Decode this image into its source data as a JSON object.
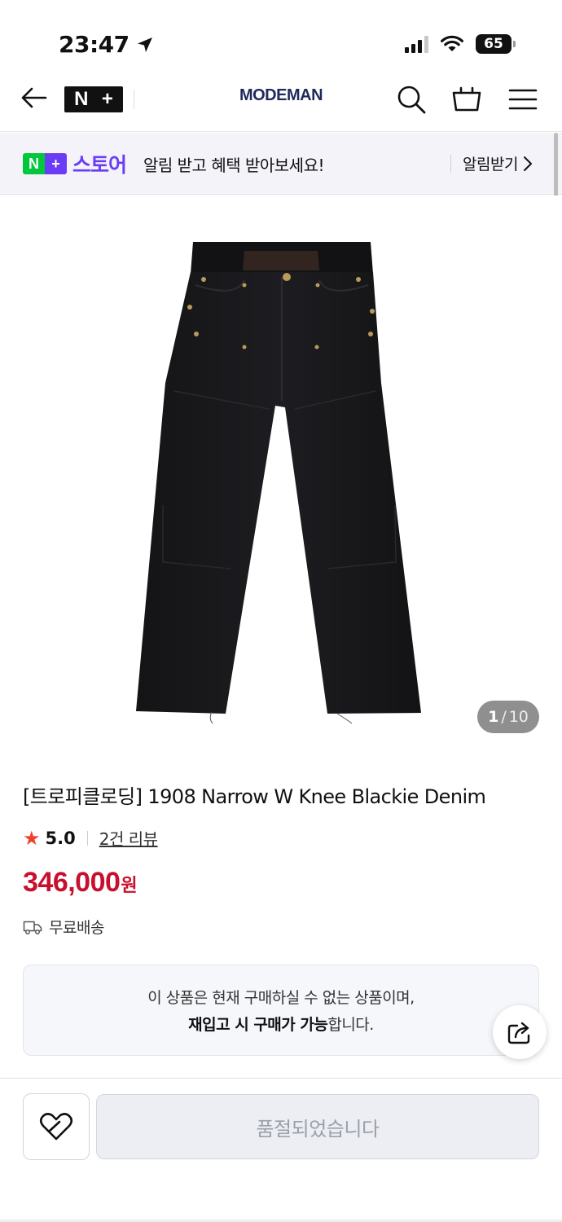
{
  "status_bar": {
    "time": "23:47",
    "battery": "65"
  },
  "header": {
    "plus_logo_n": "N",
    "plus_logo_plus": "+",
    "brand": "MODEMAN"
  },
  "store_banner": {
    "logo_n": "N",
    "logo_plus": "+",
    "store_label": "스토어",
    "message": "알림 받고 혜택 받아보세요!",
    "action_label": "알림받기",
    "colors": {
      "logo_green": "#00c73c",
      "logo_purple": "#6b3cf5"
    }
  },
  "gallery": {
    "current": "1",
    "separator": "/",
    "total": "10"
  },
  "product": {
    "title": "[트로피클로딩] 1908 Narrow W Knee Blackie Denim",
    "rating": "5.0",
    "review_count_label": "2건 리뷰",
    "price": "346,000",
    "price_unit": "원",
    "shipping": "무료배송"
  },
  "notice": {
    "line1": "이 상품은 현재 구매하실 수 없는 상품이며,",
    "line2_bold": "재입고 시 구매가 가능",
    "line2_rest": "합니다."
  },
  "bottom_bar": {
    "soldout_label": "품절되었습니다"
  },
  "colors": {
    "price": "#c8102e",
    "star": "#f0402a",
    "brand": "#1f2a5a"
  }
}
